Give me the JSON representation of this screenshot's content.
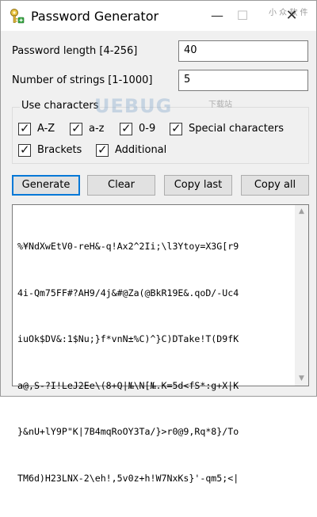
{
  "window": {
    "title": "Password Generator",
    "minimize_glyph": "—",
    "maximize_glyph": "☐",
    "close_glyph": "✕",
    "corner_watermark": "小 众 软 件"
  },
  "fields": {
    "length_label": "Password length [4-256]",
    "length_value": "40",
    "count_label": "Number of strings [1-1000]",
    "count_value": "5"
  },
  "charset": {
    "title": "Use characters",
    "watermark": "UEBUG",
    "watermark_sub": "下载站",
    "options": [
      {
        "label": "A-Z",
        "checked": true
      },
      {
        "label": "a-z",
        "checked": true
      },
      {
        "label": "0-9",
        "checked": true
      },
      {
        "label": "Special characters",
        "checked": true
      },
      {
        "label": "Brackets",
        "checked": true
      },
      {
        "label": "Additional",
        "checked": true
      }
    ],
    "check_glyph": "✓"
  },
  "buttons": {
    "generate": "Generate",
    "clear": "Clear",
    "copy_last": "Copy last",
    "copy_all": "Copy all"
  },
  "output": {
    "lines": [
      "%¥NdXwEtV0-reH&-q!Ax2^2Ii;\\l3Ytoy=X3G[r9",
      "4i-Qm75FF#?AH9/4j&#@Za(@BkR19E&.qoD/-Uc4",
      "iuOk$DV&:1$Nu;}f*vnN±%C)^}C)DTake!T(D9fK",
      "a@,S-?I!LeJ2Ee\\(8+Q|№\\N[№.K=5d<fS*:g+X|K",
      "}&nU+lY9P\"K|7B4mqRoOY3Ta/}>r0@9,Rq*8}/To",
      "TM6d)H23LNX-2\\eh!,5v0z+h!W7NxKs}'-qm5;<|"
    ],
    "scroll_up_glyph": "▲",
    "scroll_down_glyph": "▼"
  },
  "colors": {
    "accent": "#0078d7",
    "window_bg": "#f0f0f0",
    "button_bg": "#e1e1e1"
  }
}
